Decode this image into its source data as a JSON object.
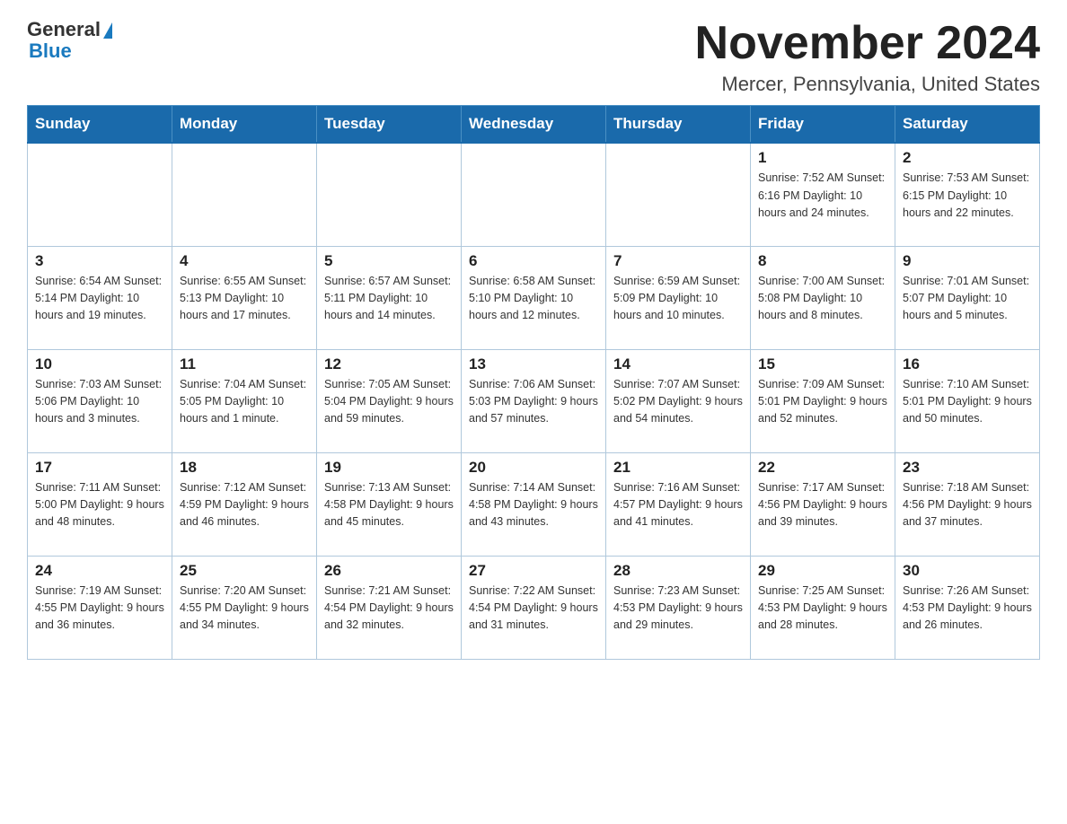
{
  "logo": {
    "general": "General",
    "blue": "Blue"
  },
  "title": "November 2024",
  "subtitle": "Mercer, Pennsylvania, United States",
  "days_of_week": [
    "Sunday",
    "Monday",
    "Tuesday",
    "Wednesday",
    "Thursday",
    "Friday",
    "Saturday"
  ],
  "weeks": [
    [
      {
        "day": "",
        "info": ""
      },
      {
        "day": "",
        "info": ""
      },
      {
        "day": "",
        "info": ""
      },
      {
        "day": "",
        "info": ""
      },
      {
        "day": "",
        "info": ""
      },
      {
        "day": "1",
        "info": "Sunrise: 7:52 AM\nSunset: 6:16 PM\nDaylight: 10 hours\nand 24 minutes."
      },
      {
        "day": "2",
        "info": "Sunrise: 7:53 AM\nSunset: 6:15 PM\nDaylight: 10 hours\nand 22 minutes."
      }
    ],
    [
      {
        "day": "3",
        "info": "Sunrise: 6:54 AM\nSunset: 5:14 PM\nDaylight: 10 hours\nand 19 minutes."
      },
      {
        "day": "4",
        "info": "Sunrise: 6:55 AM\nSunset: 5:13 PM\nDaylight: 10 hours\nand 17 minutes."
      },
      {
        "day": "5",
        "info": "Sunrise: 6:57 AM\nSunset: 5:11 PM\nDaylight: 10 hours\nand 14 minutes."
      },
      {
        "day": "6",
        "info": "Sunrise: 6:58 AM\nSunset: 5:10 PM\nDaylight: 10 hours\nand 12 minutes."
      },
      {
        "day": "7",
        "info": "Sunrise: 6:59 AM\nSunset: 5:09 PM\nDaylight: 10 hours\nand 10 minutes."
      },
      {
        "day": "8",
        "info": "Sunrise: 7:00 AM\nSunset: 5:08 PM\nDaylight: 10 hours\nand 8 minutes."
      },
      {
        "day": "9",
        "info": "Sunrise: 7:01 AM\nSunset: 5:07 PM\nDaylight: 10 hours\nand 5 minutes."
      }
    ],
    [
      {
        "day": "10",
        "info": "Sunrise: 7:03 AM\nSunset: 5:06 PM\nDaylight: 10 hours\nand 3 minutes."
      },
      {
        "day": "11",
        "info": "Sunrise: 7:04 AM\nSunset: 5:05 PM\nDaylight: 10 hours\nand 1 minute."
      },
      {
        "day": "12",
        "info": "Sunrise: 7:05 AM\nSunset: 5:04 PM\nDaylight: 9 hours\nand 59 minutes."
      },
      {
        "day": "13",
        "info": "Sunrise: 7:06 AM\nSunset: 5:03 PM\nDaylight: 9 hours\nand 57 minutes."
      },
      {
        "day": "14",
        "info": "Sunrise: 7:07 AM\nSunset: 5:02 PM\nDaylight: 9 hours\nand 54 minutes."
      },
      {
        "day": "15",
        "info": "Sunrise: 7:09 AM\nSunset: 5:01 PM\nDaylight: 9 hours\nand 52 minutes."
      },
      {
        "day": "16",
        "info": "Sunrise: 7:10 AM\nSunset: 5:01 PM\nDaylight: 9 hours\nand 50 minutes."
      }
    ],
    [
      {
        "day": "17",
        "info": "Sunrise: 7:11 AM\nSunset: 5:00 PM\nDaylight: 9 hours\nand 48 minutes."
      },
      {
        "day": "18",
        "info": "Sunrise: 7:12 AM\nSunset: 4:59 PM\nDaylight: 9 hours\nand 46 minutes."
      },
      {
        "day": "19",
        "info": "Sunrise: 7:13 AM\nSunset: 4:58 PM\nDaylight: 9 hours\nand 45 minutes."
      },
      {
        "day": "20",
        "info": "Sunrise: 7:14 AM\nSunset: 4:58 PM\nDaylight: 9 hours\nand 43 minutes."
      },
      {
        "day": "21",
        "info": "Sunrise: 7:16 AM\nSunset: 4:57 PM\nDaylight: 9 hours\nand 41 minutes."
      },
      {
        "day": "22",
        "info": "Sunrise: 7:17 AM\nSunset: 4:56 PM\nDaylight: 9 hours\nand 39 minutes."
      },
      {
        "day": "23",
        "info": "Sunrise: 7:18 AM\nSunset: 4:56 PM\nDaylight: 9 hours\nand 37 minutes."
      }
    ],
    [
      {
        "day": "24",
        "info": "Sunrise: 7:19 AM\nSunset: 4:55 PM\nDaylight: 9 hours\nand 36 minutes."
      },
      {
        "day": "25",
        "info": "Sunrise: 7:20 AM\nSunset: 4:55 PM\nDaylight: 9 hours\nand 34 minutes."
      },
      {
        "day": "26",
        "info": "Sunrise: 7:21 AM\nSunset: 4:54 PM\nDaylight: 9 hours\nand 32 minutes."
      },
      {
        "day": "27",
        "info": "Sunrise: 7:22 AM\nSunset: 4:54 PM\nDaylight: 9 hours\nand 31 minutes."
      },
      {
        "day": "28",
        "info": "Sunrise: 7:23 AM\nSunset: 4:53 PM\nDaylight: 9 hours\nand 29 minutes."
      },
      {
        "day": "29",
        "info": "Sunrise: 7:25 AM\nSunset: 4:53 PM\nDaylight: 9 hours\nand 28 minutes."
      },
      {
        "day": "30",
        "info": "Sunrise: 7:26 AM\nSunset: 4:53 PM\nDaylight: 9 hours\nand 26 minutes."
      }
    ]
  ]
}
